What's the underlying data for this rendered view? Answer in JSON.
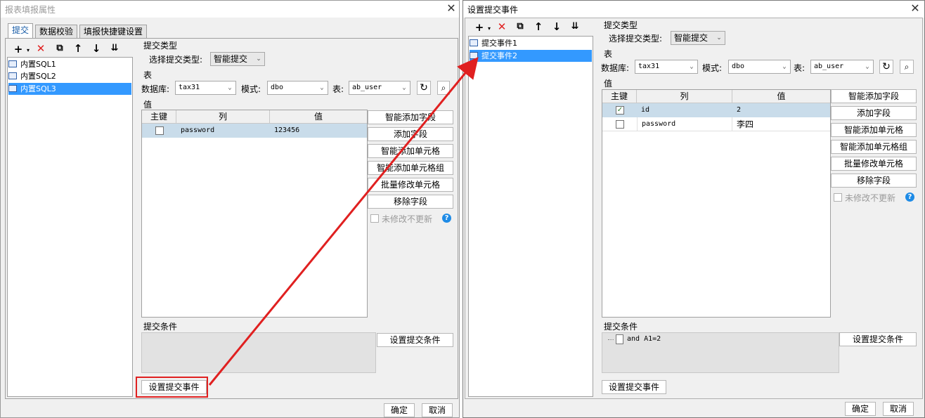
{
  "left_window": {
    "title": "报表填报属性",
    "tabs": [
      {
        "label": "提交"
      },
      {
        "label": "数据校验"
      },
      {
        "label": "填报快捷键设置"
      }
    ],
    "tree_items": [
      {
        "label": "内置SQL1"
      },
      {
        "label": "内置SQL2"
      },
      {
        "label": "内置SQL3"
      }
    ],
    "submit_type_group": "提交类型",
    "submit_type_label": "选择提交类型:",
    "submit_type_value": "智能提交",
    "table_group": "表",
    "db_label": "数据库:",
    "db_value": "tax31",
    "schema_label": "模式:",
    "schema_value": "dbo",
    "table_label": "表:",
    "table_value": "ab_user",
    "value_group": "值",
    "grid_headers": {
      "key": "主键",
      "column": "列",
      "value": "值"
    },
    "rows": [
      {
        "key": false,
        "column": "password",
        "value": "123456"
      }
    ],
    "buttons": {
      "smart_add_field": "智能添加字段",
      "add_field": "添加字段",
      "smart_add_cell": "智能添加单元格",
      "smart_add_cell_group": "智能添加单元格组",
      "batch_modify_cell": "批量修改单元格",
      "remove_field": "移除字段",
      "set_condition": "设置提交条件",
      "set_event": "设置提交事件",
      "ok": "确定",
      "cancel": "取消"
    },
    "no_update_label": "未修改不更新",
    "condition_group": "提交条件"
  },
  "right_window": {
    "title": "设置提交事件",
    "tree_items": [
      {
        "label": "提交事件1"
      },
      {
        "label": "提交事件2"
      }
    ],
    "submit_type_group": "提交类型",
    "submit_type_label": "选择提交类型:",
    "submit_type_value": "智能提交",
    "table_group": "表",
    "db_label": "数据库:",
    "db_value": "tax31",
    "schema_label": "模式:",
    "schema_value": "dbo",
    "table_label": "表:",
    "table_value": "ab_user",
    "value_group": "值",
    "grid_headers": {
      "key": "主键",
      "column": "列",
      "value": "值"
    },
    "rows": [
      {
        "key": true,
        "column": "id",
        "value": "2"
      },
      {
        "key": false,
        "column": "password",
        "value": "李四"
      }
    ],
    "buttons": {
      "smart_add_field": "智能添加字段",
      "add_field": "添加字段",
      "smart_add_cell": "智能添加单元格",
      "smart_add_cell_group": "智能添加单元格组",
      "batch_modify_cell": "批量修改单元格",
      "remove_field": "移除字段",
      "set_condition": "设置提交条件",
      "set_event": "设置提交事件",
      "ok": "确定",
      "cancel": "取消"
    },
    "no_update_label": "未修改不更新",
    "condition_group": "提交条件",
    "condition_expr": "and A1=2"
  },
  "colors": {
    "selection": "#3399ff",
    "row_highlight": "#c9dcea",
    "annotation_red": "#e02020",
    "help_blue": "#1e8be6"
  }
}
